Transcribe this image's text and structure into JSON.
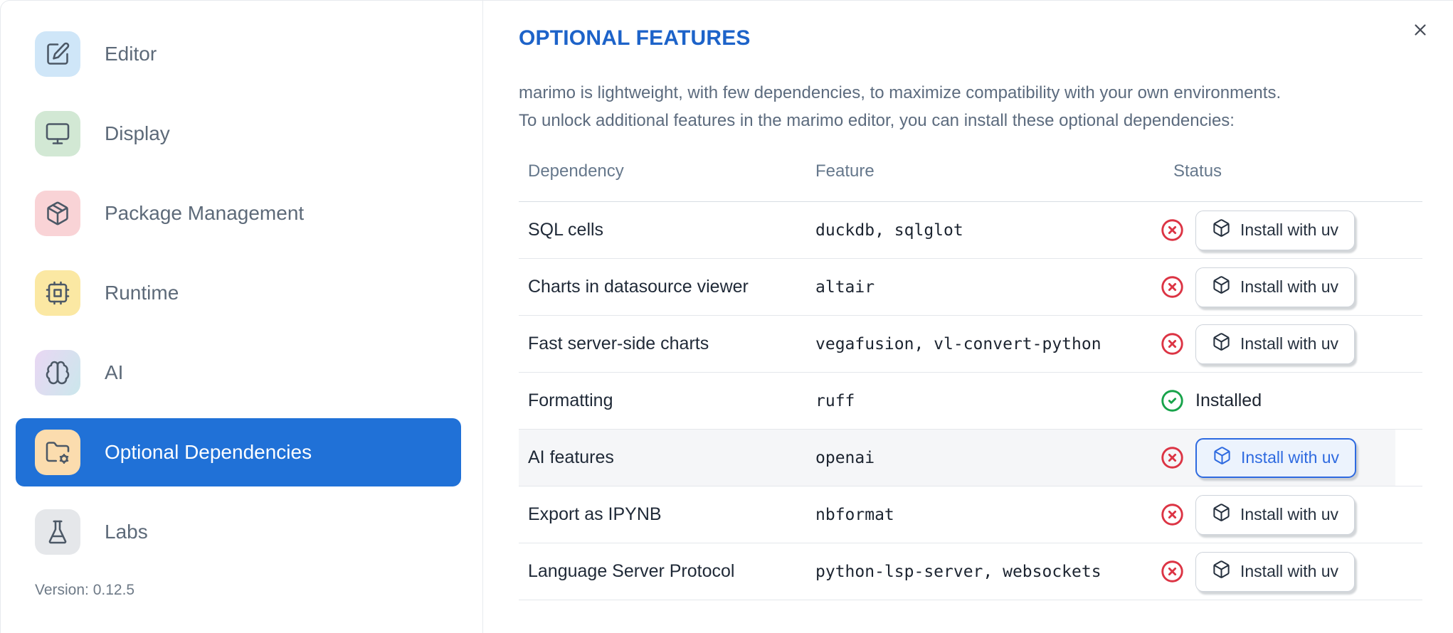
{
  "dialog": {
    "close_icon": "x"
  },
  "sidebar": {
    "items": [
      {
        "label": "Editor",
        "icon": "editor",
        "icon_bg": "#cfe6f8",
        "selected": false
      },
      {
        "label": "Display",
        "icon": "display",
        "icon_bg": "#d2e8d4",
        "selected": false
      },
      {
        "label": "Package Management",
        "icon": "package",
        "icon_bg": "#f9d3d6",
        "selected": false
      },
      {
        "label": "Runtime",
        "icon": "runtime",
        "icon_bg": "#fbe8a3",
        "selected": false
      },
      {
        "label": "AI",
        "icon": "ai",
        "icon_bg": "linear-gradient(115deg,#e9d7f3,#cbe7ec)",
        "selected": false
      },
      {
        "label": "Optional Dependencies",
        "icon": "folder-cog",
        "icon_bg": "#fbdcae",
        "selected": true
      },
      {
        "label": "Labs",
        "icon": "labs",
        "icon_bg": "#e5e7ea",
        "selected": false
      }
    ],
    "version_label": "Version: 0.12.5"
  },
  "main": {
    "title": "OPTIONAL FEATURES",
    "description_line1": "marimo is lightweight, with few dependencies, to maximize compatibility with your own environments.",
    "description_line2": "To unlock additional features in the marimo editor, you can install these optional dependencies:",
    "table": {
      "columns": [
        "Dependency",
        "Feature",
        "Status"
      ],
      "rows": [
        {
          "dependency": "SQL cells",
          "feature": "duckdb, sqlglot",
          "status": "missing",
          "action": "Install with uv",
          "highlighted": false
        },
        {
          "dependency": "Charts in datasource viewer",
          "feature": "altair",
          "status": "missing",
          "action": "Install with uv",
          "highlighted": false
        },
        {
          "dependency": "Fast server-side charts",
          "feature": "vegafusion, vl-convert-python",
          "status": "missing",
          "action": "Install with uv",
          "highlighted": false
        },
        {
          "dependency": "Formatting",
          "feature": "ruff",
          "status": "installed",
          "status_label": "Installed",
          "highlighted": false
        },
        {
          "dependency": "AI features",
          "feature": "openai",
          "status": "missing",
          "action": "Install with uv",
          "highlighted": true
        },
        {
          "dependency": "Export as IPYNB",
          "feature": "nbformat",
          "status": "missing",
          "action": "Install with uv",
          "highlighted": false
        },
        {
          "dependency": "Language Server Protocol",
          "feature": "python-lsp-server, websockets",
          "status": "missing",
          "action": "Install with uv",
          "highlighted": false
        }
      ]
    }
  },
  "colors": {
    "accent_selected_blue": "#2071d7",
    "title_blue": "#1d63c9",
    "status_red": "#dc3444",
    "status_green": "#17a34a",
    "focus_button_blue": "#2e6ae0",
    "row_highlight": "#f5f6f8"
  }
}
